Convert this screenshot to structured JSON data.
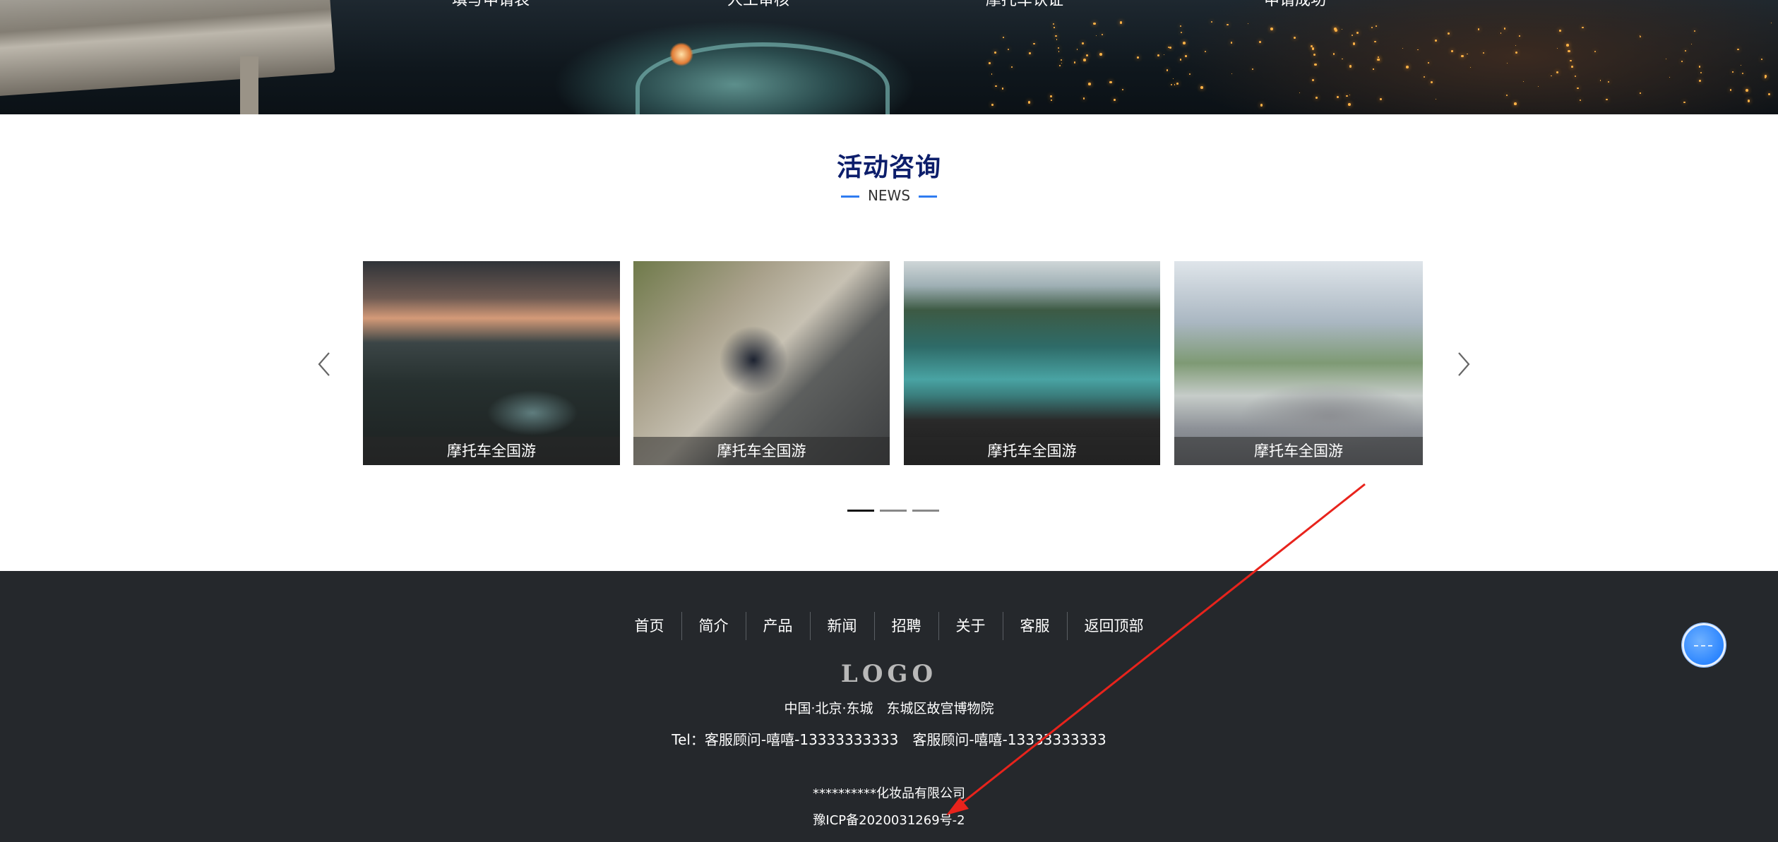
{
  "hero": {
    "steps": [
      "填写申请表",
      "人工审核",
      "摩托车认证",
      "申请成功"
    ]
  },
  "news": {
    "title": "活动咨询",
    "subtitle": "NEWS",
    "cards": [
      {
        "caption": "摩托车全国游"
      },
      {
        "caption": "摩托车全国游"
      },
      {
        "caption": "摩托车全国游"
      },
      {
        "caption": "摩托车全国游"
      }
    ],
    "pagination": {
      "pages": 3,
      "active": 1
    },
    "colors": {
      "dash": "#2f7cf0",
      "title": "#0d1e6b",
      "dot_active": "#111111",
      "dot_inactive": "#888888"
    }
  },
  "footer": {
    "nav": [
      "首页",
      "简介",
      "产品",
      "新闻",
      "招聘",
      "关于",
      "客服",
      "返回顶部"
    ],
    "logo": "LOGO",
    "address": "中国·北京·东城　东城区故宫博物院",
    "tel": "Tel：客服顾问-嘻嘻-13333333333　客服顾问-嘻嘻-13333333333",
    "company": "**********化妆品有限公司",
    "icp": "豫ICP备2020031269号-2",
    "background": "#25282c"
  },
  "icons": {
    "prev": "chevron-left-icon",
    "next": "chevron-right-icon",
    "float": "customer-service-icon"
  },
  "annotation": {
    "color": "#e8231c"
  }
}
